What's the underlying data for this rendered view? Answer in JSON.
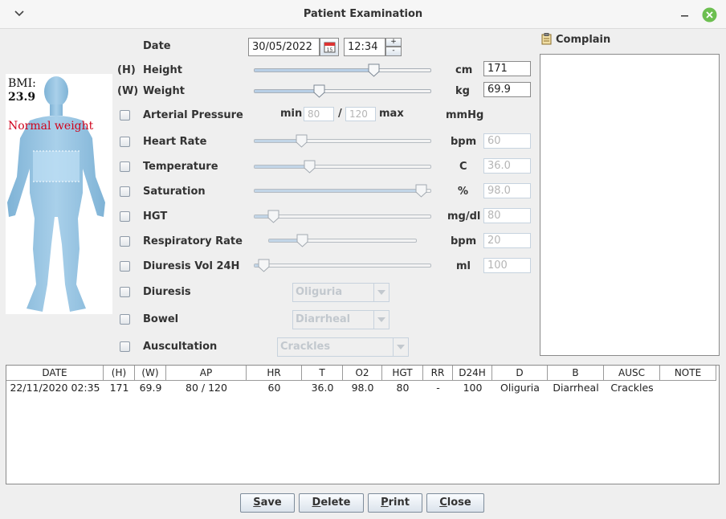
{
  "window": {
    "title": "Patient Examination",
    "menu_icon": "chevron-down-icon",
    "minimize_icon": "minimize-icon",
    "close_icon": "close-icon",
    "close_color": "#6cbf50"
  },
  "form": {
    "date": {
      "label": "Date",
      "value": "30/05/2022",
      "time": "12:34",
      "calendar_icon": "calendar-icon",
      "spin_up": "+",
      "spin_down": "-"
    },
    "height": {
      "prefix": "(H)",
      "label": "Height",
      "unit": "cm",
      "value": "171"
    },
    "weight": {
      "prefix": "(W)",
      "label": "Weight",
      "unit": "kg",
      "value": "69.9"
    },
    "ap": {
      "label": "Arterial Pressure",
      "min_label": "min",
      "min_value": "80",
      "sep": "/",
      "max_value": "120",
      "max_label": "max",
      "unit": "mmHg"
    },
    "heart_rate": {
      "label": "Heart Rate",
      "unit": "bpm",
      "value": "60"
    },
    "temperature": {
      "label": "Temperature",
      "unit": "C",
      "value": "36.0"
    },
    "saturation": {
      "label": "Saturation",
      "unit": "%",
      "value": "98.0"
    },
    "hgt": {
      "label": "HGT",
      "unit": "mg/dl",
      "value": "80"
    },
    "resp_rate": {
      "label": "Respiratory Rate",
      "unit": "bpm",
      "value": "20"
    },
    "diuresis_vol": {
      "label": "Diuresis Vol 24H",
      "unit": "ml",
      "value": "100"
    },
    "diuresis": {
      "label": "Diuresis",
      "value": "Oliguria"
    },
    "bowel": {
      "label": "Bowel",
      "value": "Diarrheal"
    },
    "auscultation": {
      "label": "Auscultation",
      "value": "Crackles"
    }
  },
  "sliders": {
    "height": 0.69,
    "weight": 0.36,
    "heart_rate": 0.25,
    "temperature": 0.3,
    "saturation": 0.98,
    "hgt": 0.08,
    "resp_rate": 0.2,
    "diuresis_vol": 0.02
  },
  "bmi": {
    "label": "BMI:",
    "value": "23.9",
    "status": "Normal weight",
    "status_color": "#d0021b"
  },
  "complain": {
    "label": "Complain",
    "icon": "clipboard-icon"
  },
  "table": {
    "columns": [
      "DATE",
      "(H)",
      "(W)",
      "AP",
      "HR",
      "T",
      "O2",
      "HGT",
      "RR",
      "D24H",
      "D",
      "B",
      "AUSC",
      "NOTE"
    ],
    "rows": [
      [
        "22/11/2020 02:35",
        "171",
        "69.9",
        "80 / 120",
        "60",
        "36.0",
        "98.0",
        "80",
        "-",
        "100",
        "Oliguria",
        "Diarrheal",
        "Crackles",
        ""
      ]
    ]
  },
  "buttons": {
    "save": {
      "mn": "S",
      "rest": "ave"
    },
    "delete": {
      "mn": "D",
      "rest": "elete"
    },
    "print": {
      "mn": "P",
      "rest": "rint"
    },
    "close": {
      "mn": "C",
      "rest": "lose"
    }
  }
}
